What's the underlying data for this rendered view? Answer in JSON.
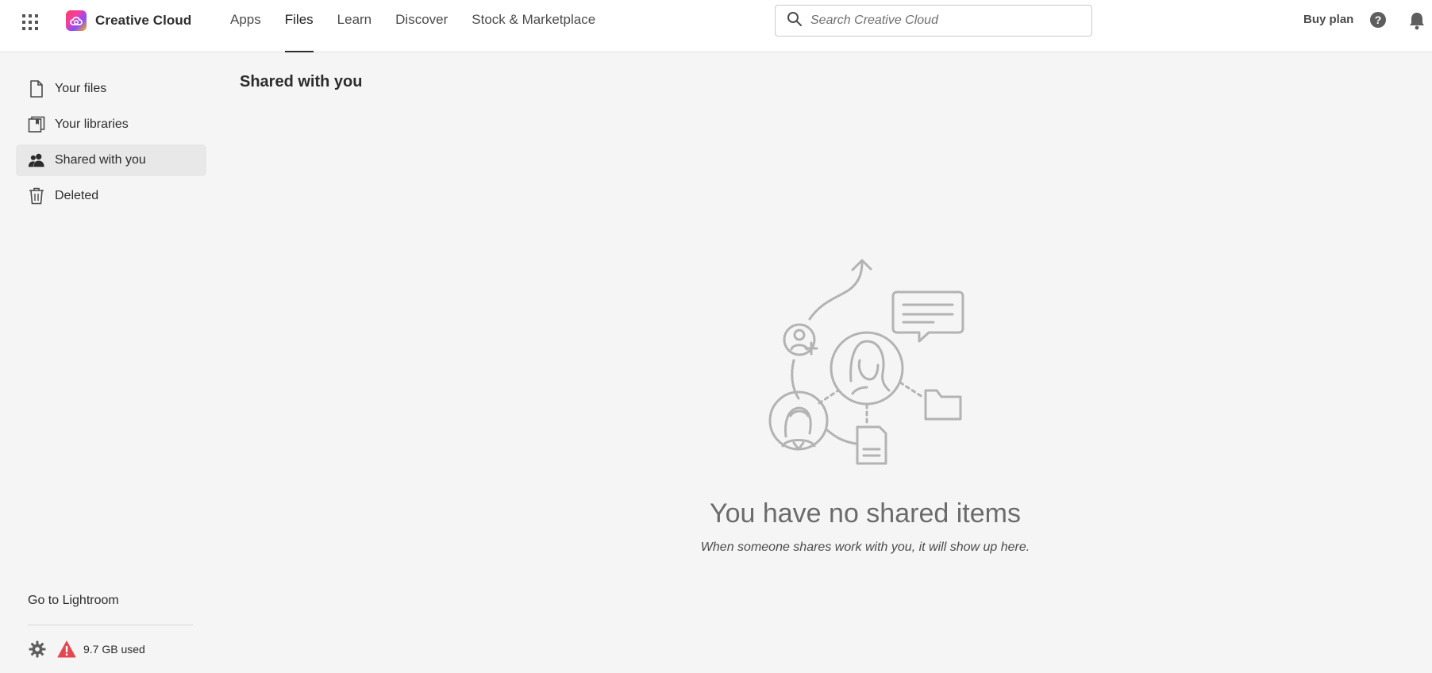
{
  "header": {
    "brand": "Creative Cloud",
    "nav": [
      {
        "label": "Apps",
        "active": false
      },
      {
        "label": "Files",
        "active": true
      },
      {
        "label": "Learn",
        "active": false
      },
      {
        "label": "Discover",
        "active": false
      },
      {
        "label": "Stock & Marketplace",
        "active": false
      }
    ],
    "search_placeholder": "Search Creative Cloud",
    "buy_plan": "Buy plan",
    "icons": [
      "apps-grid-icon",
      "search-icon",
      "help-icon",
      "bell-icon"
    ]
  },
  "sidebar": {
    "items": [
      {
        "label": "Your files",
        "icon": "file-icon",
        "active": false
      },
      {
        "label": "Your libraries",
        "icon": "libraries-icon",
        "active": false
      },
      {
        "label": "Shared with you",
        "icon": "people-icon",
        "active": true
      },
      {
        "label": "Deleted",
        "icon": "trash-icon",
        "active": false
      }
    ],
    "go_to": "Go to Lightroom",
    "storage_used": "9.7 GB used"
  },
  "main": {
    "title": "Shared with you",
    "empty_title": "You have no shared items",
    "empty_subtitle": "When someone shares work with you, it will show up here."
  },
  "colors": {
    "accent_underline": "#2c2c2c",
    "active_bg": "#e8e8e8",
    "alert": "#e34850",
    "illustration": "#b3b3b3"
  }
}
